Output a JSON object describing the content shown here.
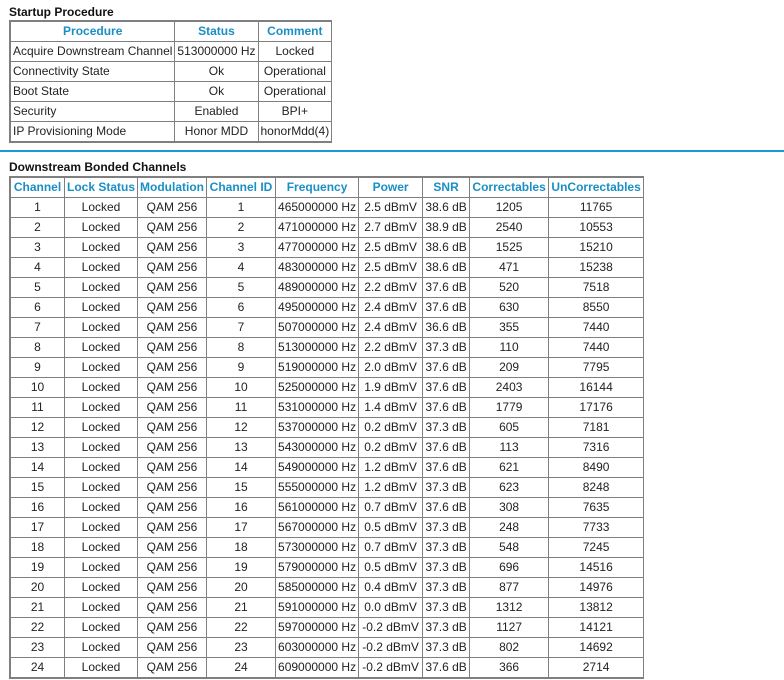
{
  "startup": {
    "title": "Startup Procedure",
    "headers": [
      "Procedure",
      "Status",
      "Comment"
    ],
    "rows": [
      [
        "Acquire Downstream Channel",
        "513000000 Hz",
        "Locked"
      ],
      [
        "Connectivity State",
        "Ok",
        "Operational"
      ],
      [
        "Boot State",
        "Ok",
        "Operational"
      ],
      [
        "Security",
        "Enabled",
        "BPI+"
      ],
      [
        "IP Provisioning Mode",
        "Honor MDD",
        "honorMdd(4)"
      ]
    ]
  },
  "downstream": {
    "title": "Downstream Bonded Channels",
    "headers": [
      "Channel",
      "Lock Status",
      "Modulation",
      "Channel ID",
      "Frequency",
      "Power",
      "SNR",
      "Correctables",
      "UnCorrectables"
    ],
    "rows": [
      [
        "1",
        "Locked",
        "QAM 256",
        "1",
        "465000000 Hz",
        "2.5 dBmV",
        "38.6 dB",
        "1205",
        "11765"
      ],
      [
        "2",
        "Locked",
        "QAM 256",
        "2",
        "471000000 Hz",
        "2.7 dBmV",
        "38.9 dB",
        "2540",
        "10553"
      ],
      [
        "3",
        "Locked",
        "QAM 256",
        "3",
        "477000000 Hz",
        "2.5 dBmV",
        "38.6 dB",
        "1525",
        "15210"
      ],
      [
        "4",
        "Locked",
        "QAM 256",
        "4",
        "483000000 Hz",
        "2.5 dBmV",
        "38.6 dB",
        "471",
        "15238"
      ],
      [
        "5",
        "Locked",
        "QAM 256",
        "5",
        "489000000 Hz",
        "2.2 dBmV",
        "37.6 dB",
        "520",
        "7518"
      ],
      [
        "6",
        "Locked",
        "QAM 256",
        "6",
        "495000000 Hz",
        "2.4 dBmV",
        "37.6 dB",
        "630",
        "8550"
      ],
      [
        "7",
        "Locked",
        "QAM 256",
        "7",
        "507000000 Hz",
        "2.4 dBmV",
        "36.6 dB",
        "355",
        "7440"
      ],
      [
        "8",
        "Locked",
        "QAM 256",
        "8",
        "513000000 Hz",
        "2.2 dBmV",
        "37.3 dB",
        "110",
        "7440"
      ],
      [
        "9",
        "Locked",
        "QAM 256",
        "9",
        "519000000 Hz",
        "2.0 dBmV",
        "37.6 dB",
        "209",
        "7795"
      ],
      [
        "10",
        "Locked",
        "QAM 256",
        "10",
        "525000000 Hz",
        "1.9 dBmV",
        "37.6 dB",
        "2403",
        "16144"
      ],
      [
        "11",
        "Locked",
        "QAM 256",
        "11",
        "531000000 Hz",
        "1.4 dBmV",
        "37.6 dB",
        "1779",
        "17176"
      ],
      [
        "12",
        "Locked",
        "QAM 256",
        "12",
        "537000000 Hz",
        "0.2 dBmV",
        "37.3 dB",
        "605",
        "7181"
      ],
      [
        "13",
        "Locked",
        "QAM 256",
        "13",
        "543000000 Hz",
        "0.2 dBmV",
        "37.6 dB",
        "113",
        "7316"
      ],
      [
        "14",
        "Locked",
        "QAM 256",
        "14",
        "549000000 Hz",
        "1.2 dBmV",
        "37.6 dB",
        "621",
        "8490"
      ],
      [
        "15",
        "Locked",
        "QAM 256",
        "15",
        "555000000 Hz",
        "1.2 dBmV",
        "37.3 dB",
        "623",
        "8248"
      ],
      [
        "16",
        "Locked",
        "QAM 256",
        "16",
        "561000000 Hz",
        "0.7 dBmV",
        "37.6 dB",
        "308",
        "7635"
      ],
      [
        "17",
        "Locked",
        "QAM 256",
        "17",
        "567000000 Hz",
        "0.5 dBmV",
        "37.3 dB",
        "248",
        "7733"
      ],
      [
        "18",
        "Locked",
        "QAM 256",
        "18",
        "573000000 Hz",
        "0.7 dBmV",
        "37.3 dB",
        "548",
        "7245"
      ],
      [
        "19",
        "Locked",
        "QAM 256",
        "19",
        "579000000 Hz",
        "0.5 dBmV",
        "37.3 dB",
        "696",
        "14516"
      ],
      [
        "20",
        "Locked",
        "QAM 256",
        "20",
        "585000000 Hz",
        "0.4 dBmV",
        "37.3 dB",
        "877",
        "14976"
      ],
      [
        "21",
        "Locked",
        "QAM 256",
        "21",
        "591000000 Hz",
        "0.0 dBmV",
        "37.3 dB",
        "1312",
        "13812"
      ],
      [
        "22",
        "Locked",
        "QAM 256",
        "22",
        "597000000 Hz",
        "-0.2 dBmV",
        "37.3 dB",
        "1127",
        "14121"
      ],
      [
        "23",
        "Locked",
        "QAM 256",
        "23",
        "603000000 Hz",
        "-0.2 dBmV",
        "37.3 dB",
        "802",
        "14692"
      ],
      [
        "24",
        "Locked",
        "QAM 256",
        "24",
        "609000000 Hz",
        "-0.2 dBmV",
        "37.6 dB",
        "366",
        "2714"
      ]
    ]
  },
  "colors": {
    "header_text": "#1a8fc6",
    "divider": "#1a9bd7",
    "border": "#7f7f7f"
  }
}
